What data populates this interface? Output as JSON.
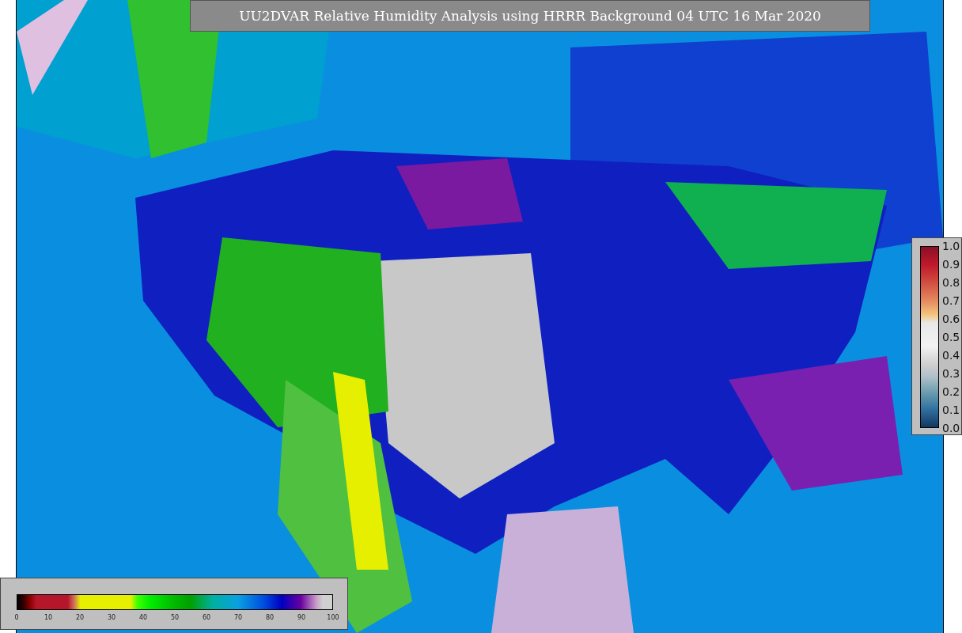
{
  "title": "UU2DVAR Relative Humidity Analysis using HRRR Background 04 UTC 16 Mar 2020",
  "humidity_legend": {
    "ticks": [
      "0",
      "10",
      "20",
      "30",
      "40",
      "50",
      "60",
      "70",
      "80",
      "90",
      "100"
    ]
  },
  "ratio_legend": {
    "ticks": [
      "1.0",
      "0.9",
      "0.8",
      "0.7",
      "0.6",
      "0.5",
      "0.4",
      "0.3",
      "0.2",
      "0.1",
      "0.0"
    ]
  }
}
